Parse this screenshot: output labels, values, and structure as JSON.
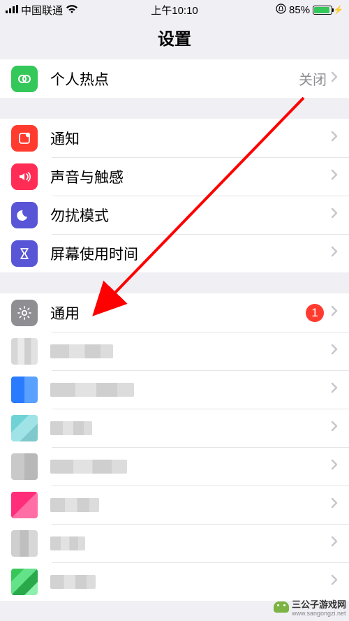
{
  "status": {
    "carrier": "中国联通",
    "time": "上午10:10",
    "battery_pct": "85%"
  },
  "title": "设置",
  "group1": {
    "hotspot": {
      "label": "个人热点",
      "value": "关闭"
    }
  },
  "group2": {
    "notify": {
      "label": "通知"
    },
    "sound": {
      "label": "声音与触感"
    },
    "dnd": {
      "label": "勿扰模式"
    },
    "screentime": {
      "label": "屏幕使用时间"
    }
  },
  "group3": {
    "general": {
      "label": "通用",
      "badge": "1"
    }
  },
  "watermark": {
    "name": "三公子游戏网",
    "url": "www.sangongzi.net"
  }
}
